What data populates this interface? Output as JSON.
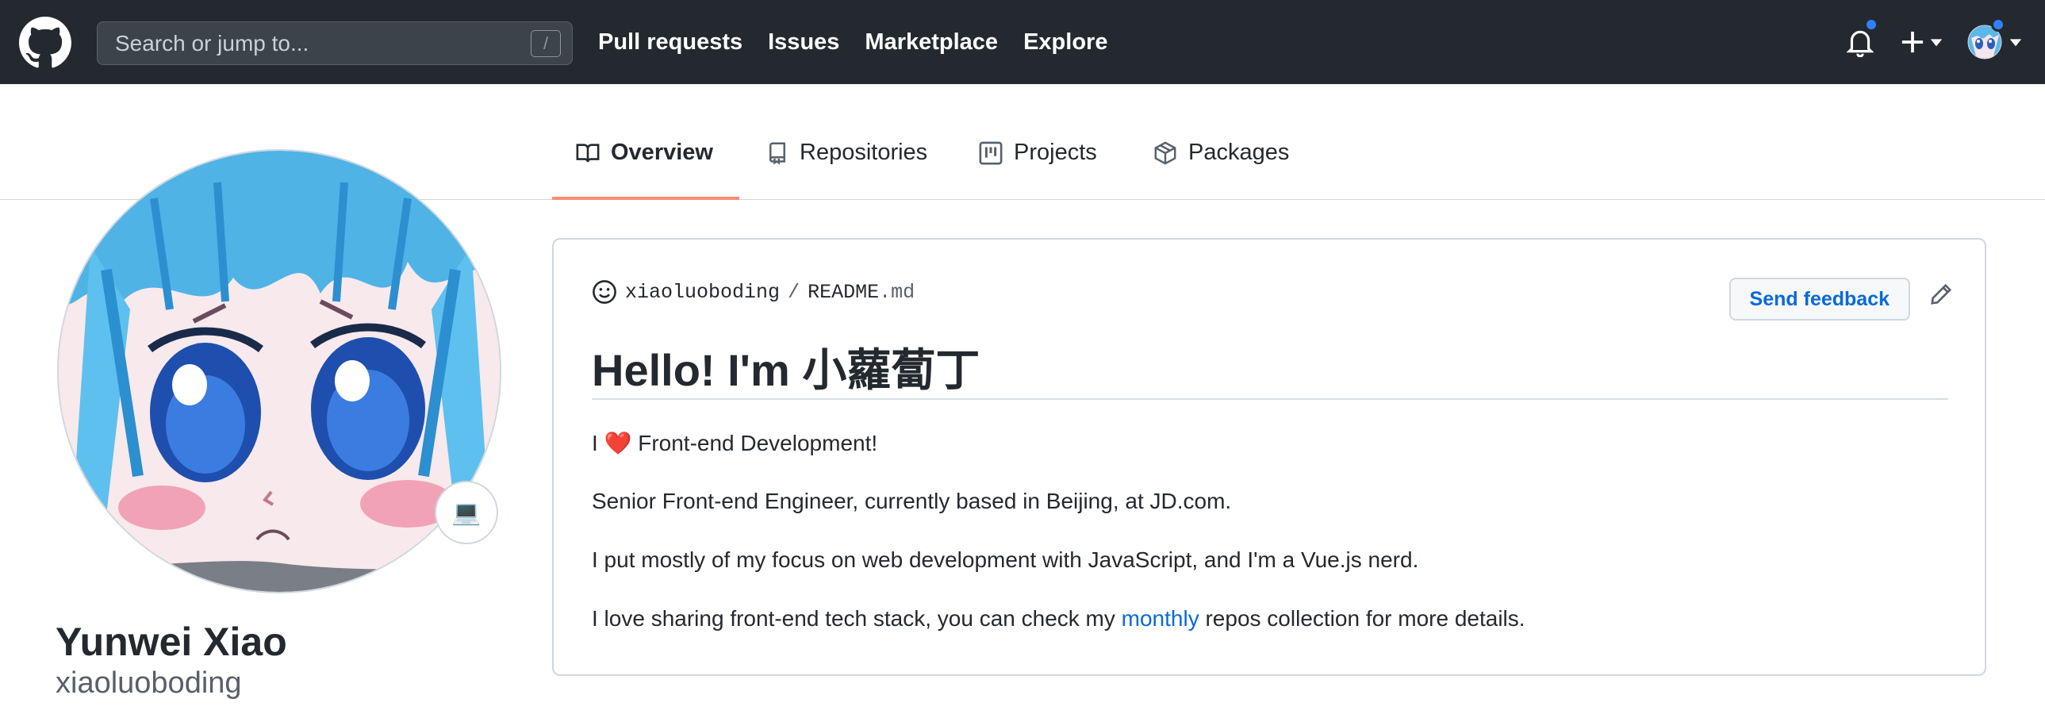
{
  "header": {
    "search_placeholder": "Search or jump to...",
    "search_shortcut": "/",
    "nav": [
      "Pull requests",
      "Issues",
      "Marketplace",
      "Explore"
    ],
    "colors": {
      "background": "#24292f",
      "notification_dot": "#2f81f7"
    }
  },
  "tabs": [
    {
      "label": "Overview",
      "icon": "book-icon",
      "selected": true
    },
    {
      "label": "Repositories",
      "icon": "repo-icon",
      "selected": false
    },
    {
      "label": "Projects",
      "icon": "project-icon",
      "selected": false
    },
    {
      "label": "Packages",
      "icon": "package-icon",
      "selected": false
    }
  ],
  "profile": {
    "full_name": "Yunwei Xiao",
    "login": "xiaoluoboding",
    "status_emoji": "💻"
  },
  "readme": {
    "owner": "xiaoluoboding",
    "separator": "/",
    "file_base": "README",
    "file_ext": ".md",
    "feedback_label": "Send feedback",
    "title": "Hello! I'm 小蘿蔔丁",
    "line1_prefix": "I ",
    "line1_heart": "❤️",
    "line1_suffix": " Front-end Development!",
    "line2": "Senior Front-end Engineer, currently based in Beijing, at JD.com.",
    "line3": "I put mostly of my focus on web development with JavaScript, and I'm a Vue.js nerd.",
    "line4_prefix": "I love sharing front-end tech stack, you can check my ",
    "line4_link": "monthly",
    "line4_suffix": " repos collection for more details."
  }
}
